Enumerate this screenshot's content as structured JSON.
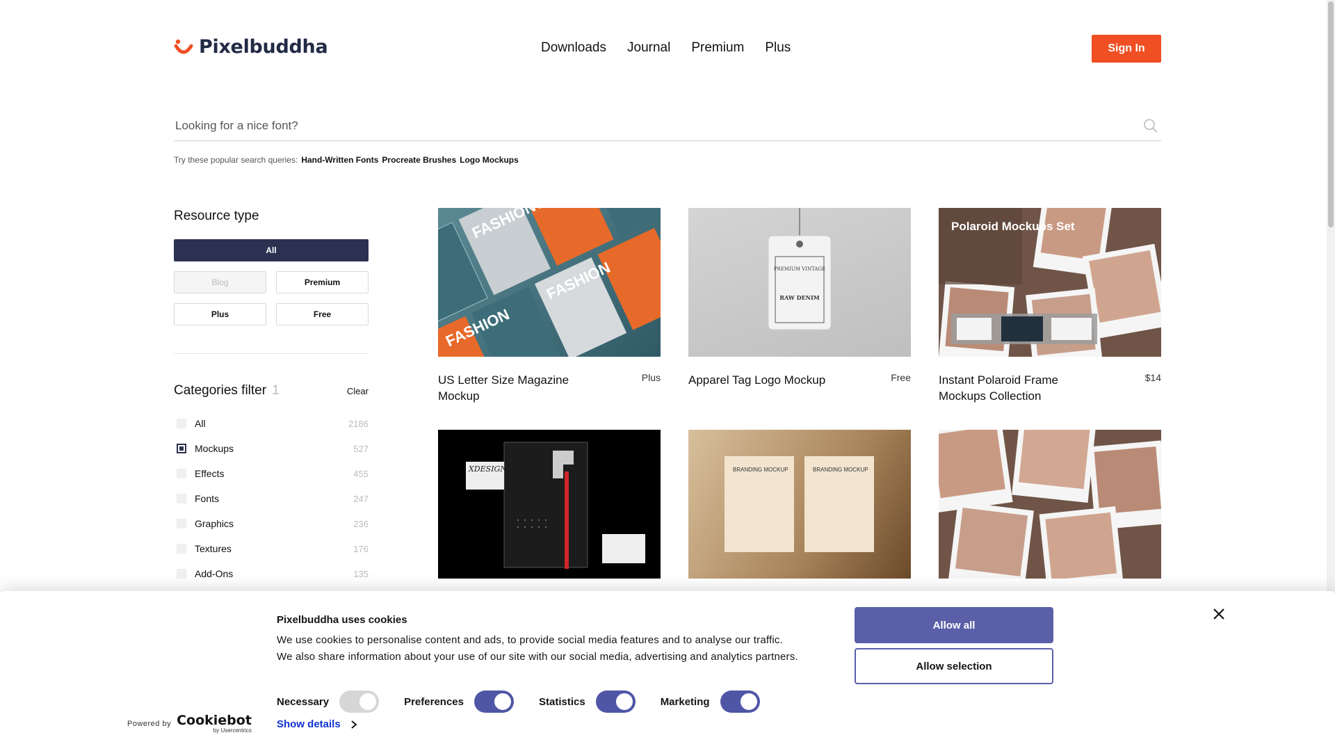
{
  "brand": {
    "name": "Pixelbuddha",
    "accent": "#f04e23",
    "navy": "#222b45"
  },
  "nav": [
    "Downloads",
    "Journal",
    "Premium",
    "Plus"
  ],
  "signin_label": "Sign In",
  "search": {
    "placeholder": "Looking for a nice font?",
    "popular_label": "Try these popular search queries:",
    "popular_queries": [
      "Hand-Written Fonts",
      "Procreate Brushes",
      "Logo Mockups"
    ]
  },
  "resource_type": {
    "title": "Resource type",
    "all_label": "All",
    "options": [
      "Blog",
      "Premium",
      "Plus",
      "Free"
    ]
  },
  "categories": {
    "title": "Categories filter",
    "count": "1",
    "clear_label": "Clear",
    "items": [
      {
        "label": "All",
        "count": "2186",
        "checked": false
      },
      {
        "label": "Mockups",
        "count": "527",
        "checked": true
      },
      {
        "label": "Effects",
        "count": "455",
        "checked": false
      },
      {
        "label": "Fonts",
        "count": "247",
        "checked": false
      },
      {
        "label": "Graphics",
        "count": "236",
        "checked": false
      },
      {
        "label": "Textures",
        "count": "176",
        "checked": false
      },
      {
        "label": "Add-Ons",
        "count": "135",
        "checked": false
      }
    ]
  },
  "cards": [
    {
      "title": "US Letter Size Magazine Mockup",
      "price": "Plus",
      "thumb_text": "FASHION"
    },
    {
      "title": "Apparel Tag Logo Mockup",
      "price": "Free",
      "thumb_text": "PREMIUM VINTAGE",
      "thumb_text2": "RAW DENIM"
    },
    {
      "title": "Instant Polaroid Frame Mockups Collection",
      "price": "$14",
      "thumb_text": "Polaroid Mockups Set"
    },
    {
      "title": "",
      "price": "",
      "thumb_text": "XDESIGN"
    },
    {
      "title": "",
      "price": "",
      "thumb_text": "BRANDING MOCKUP"
    },
    {
      "title": "",
      "price": "",
      "thumb_text": ""
    }
  ],
  "cookie": {
    "title": "Pixelbuddha uses cookies",
    "line1": "We use cookies to personalise content and ads, to provide social media features and to analyse our traffic.",
    "line2": "We also share information about your use of our site with our social media, advertising and analytics partners.",
    "toggles": [
      {
        "label": "Necessary",
        "on": true,
        "disabled": true
      },
      {
        "label": "Preferences",
        "on": true,
        "disabled": false
      },
      {
        "label": "Statistics",
        "on": true,
        "disabled": false
      },
      {
        "label": "Marketing",
        "on": true,
        "disabled": false
      }
    ],
    "show_details": "Show details",
    "allow_all": "Allow all",
    "allow_selection": "Allow selection",
    "powered_by": "Powered by",
    "cookiebot": "Cookiebot",
    "cookiebot_sub": "by Usercentrics"
  }
}
